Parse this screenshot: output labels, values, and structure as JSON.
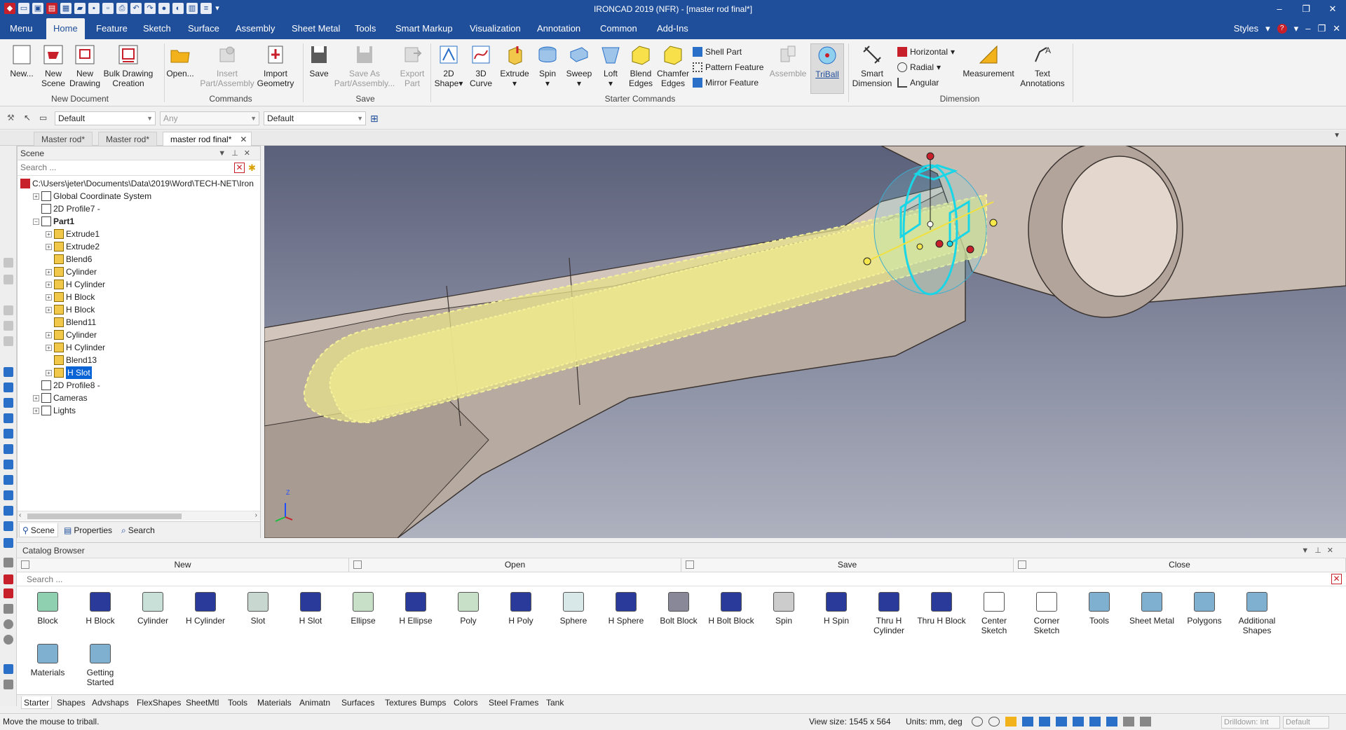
{
  "window": {
    "title": "IRONCAD 2019 (NFR) - [master rod final*]",
    "controls": [
      "–",
      "❐",
      "✕"
    ]
  },
  "ribbon_tabs": [
    "Menu",
    "Home",
    "Feature",
    "Sketch",
    "Surface",
    "Assembly",
    "Sheet Metal",
    "Tools",
    "Smart Markup",
    "Visualization",
    "Annotation",
    "Common",
    "Add-Ins"
  ],
  "ribbon_right": {
    "styles": "Styles"
  },
  "ribbon": {
    "new_document": {
      "label": "New Document",
      "buttons": [
        {
          "line1": "New...",
          "line2": ""
        },
        {
          "line1": "New",
          "line2": "Scene"
        },
        {
          "line1": "New",
          "line2": "Drawing"
        },
        {
          "line1": "Bulk Drawing",
          "line2": "Creation"
        }
      ]
    },
    "commands": {
      "label": "Commands",
      "buttons": [
        {
          "line1": "Open...",
          "line2": ""
        },
        {
          "line1": "Insert",
          "line2": "Part/Assembly"
        },
        {
          "line1": "Import",
          "line2": "Geometry"
        }
      ]
    },
    "save": {
      "label": "Save",
      "buttons": [
        {
          "line1": "Save",
          "line2": ""
        },
        {
          "line1": "Save As",
          "line2": "Part/Assembly..."
        },
        {
          "line1": "Export",
          "line2": "Part"
        }
      ]
    },
    "starter": {
      "label": "Starter Commands",
      "buttons": [
        {
          "line1": "2D",
          "line2": "Shape"
        },
        {
          "line1": "3D",
          "line2": "Curve"
        },
        {
          "line1": "Extrude",
          "line2": ""
        },
        {
          "line1": "Spin",
          "line2": ""
        },
        {
          "line1": "Sweep",
          "line2": ""
        },
        {
          "line1": "Loft",
          "line2": ""
        },
        {
          "line1": "Blend",
          "line2": "Edges"
        },
        {
          "line1": "Chamfer",
          "line2": "Edges"
        }
      ],
      "small": [
        "Shell Part",
        "Pattern Feature",
        "Mirror Feature"
      ],
      "assemble": "Assemble",
      "triball": "TriBall"
    },
    "dimension": {
      "label": "Dimension",
      "smart": {
        "line1": "Smart",
        "line2": "Dimension"
      },
      "small": [
        "Horizontal",
        "Radial",
        "Angular"
      ],
      "measurement": "Measurement",
      "text": {
        "line1": "Text",
        "line2": "Annotations"
      }
    }
  },
  "toolbar": {
    "combo1": "Default",
    "combo2_placeholder": "Any",
    "combo3": "Default"
  },
  "doc_tabs": [
    "Master rod*",
    "Master rod*",
    "master rod final*"
  ],
  "scene_panel": {
    "title": "Scene",
    "search_placeholder": "Search ...",
    "tree": [
      {
        "label": "C:\\Users\\jeter\\Documents\\Data\\2019\\Word\\TECH-NET\\Iron",
        "level": 0,
        "expander": false
      },
      {
        "label": "Global Coordinate System",
        "level": 1,
        "expander": true
      },
      {
        "label": "2D Profile7 -",
        "level": 1,
        "expander": false
      },
      {
        "label": "Part1",
        "level": 1,
        "expander": true,
        "bold": true,
        "open": true
      },
      {
        "label": "Extrude1",
        "level": 2,
        "expander": true
      },
      {
        "label": "Extrude2",
        "level": 2,
        "expander": true
      },
      {
        "label": "Blend6",
        "level": 2,
        "expander": false
      },
      {
        "label": "Cylinder",
        "level": 2,
        "expander": true
      },
      {
        "label": "H Cylinder",
        "level": 2,
        "expander": true
      },
      {
        "label": "H Block",
        "level": 2,
        "expander": true
      },
      {
        "label": "H Block",
        "level": 2,
        "expander": true
      },
      {
        "label": "Blend11",
        "level": 2,
        "expander": false
      },
      {
        "label": "Cylinder",
        "level": 2,
        "expander": true
      },
      {
        "label": "H Cylinder",
        "level": 2,
        "expander": true
      },
      {
        "label": "Blend13",
        "level": 2,
        "expander": false
      },
      {
        "label": "H Slot",
        "level": 2,
        "expander": true,
        "selected": true
      },
      {
        "label": "2D Profile8 -",
        "level": 1,
        "expander": false
      },
      {
        "label": "Cameras",
        "level": 1,
        "expander": true
      },
      {
        "label": "Lights",
        "level": 1,
        "expander": true
      }
    ],
    "bottom_tabs": [
      "Scene",
      "Properties",
      "Search"
    ]
  },
  "viewport": {
    "axis_label": "Z"
  },
  "catalog": {
    "title": "Catalog Browser",
    "buttons": [
      "New",
      "Open",
      "Save",
      "Close"
    ],
    "search_placeholder": "Search ...",
    "items": [
      {
        "line1": "Block",
        "line2": ""
      },
      {
        "line1": "H Block",
        "line2": ""
      },
      {
        "line1": "Cylinder",
        "line2": ""
      },
      {
        "line1": "H Cylinder",
        "line2": ""
      },
      {
        "line1": "Slot",
        "line2": ""
      },
      {
        "line1": "H Slot",
        "line2": ""
      },
      {
        "line1": "Ellipse",
        "line2": ""
      },
      {
        "line1": "H Ellipse",
        "line2": ""
      },
      {
        "line1": "Poly",
        "line2": ""
      },
      {
        "line1": "H Poly",
        "line2": ""
      },
      {
        "line1": "Sphere",
        "line2": ""
      },
      {
        "line1": "H Sphere",
        "line2": ""
      },
      {
        "line1": "Bolt Block",
        "line2": ""
      },
      {
        "line1": "H Bolt Block",
        "line2": ""
      },
      {
        "line1": "Spin",
        "line2": ""
      },
      {
        "line1": "H Spin",
        "line2": ""
      },
      {
        "line1": "Thru H",
        "line2": "Cylinder"
      },
      {
        "line1": "Thru H Block",
        "line2": ""
      },
      {
        "line1": "Center",
        "line2": "Sketch"
      },
      {
        "line1": "Corner",
        "line2": "Sketch"
      },
      {
        "line1": "Tools",
        "line2": ""
      },
      {
        "line1": "Sheet Metal",
        "line2": ""
      },
      {
        "line1": "Polygons",
        "line2": ""
      },
      {
        "line1": "Additional",
        "line2": "Shapes"
      },
      {
        "line1": "Materials",
        "line2": ""
      },
      {
        "line1": "Getting",
        "line2": "Started"
      }
    ],
    "tabs": [
      "Starter",
      "Shapes",
      "Advshaps",
      "FlexShapes",
      "SheetMtl",
      "Tools",
      "Materials",
      "Animatn",
      "Surfaces",
      "Textures",
      "Bumps",
      "Colors",
      "Steel Frames",
      "Tank"
    ]
  },
  "status": {
    "message": "Move the mouse to triball.",
    "view_size": "View size: 1545 x  564",
    "units": "Units: mm, deg",
    "drilldown": "Drilldown: Int",
    "default": "Default"
  },
  "colors": {
    "title_bar": "#1f4e9a",
    "selection": "#0a64d6",
    "slot_fill": "#e6e08a",
    "triball": "#19d6e6",
    "part": "#b9aca2"
  }
}
